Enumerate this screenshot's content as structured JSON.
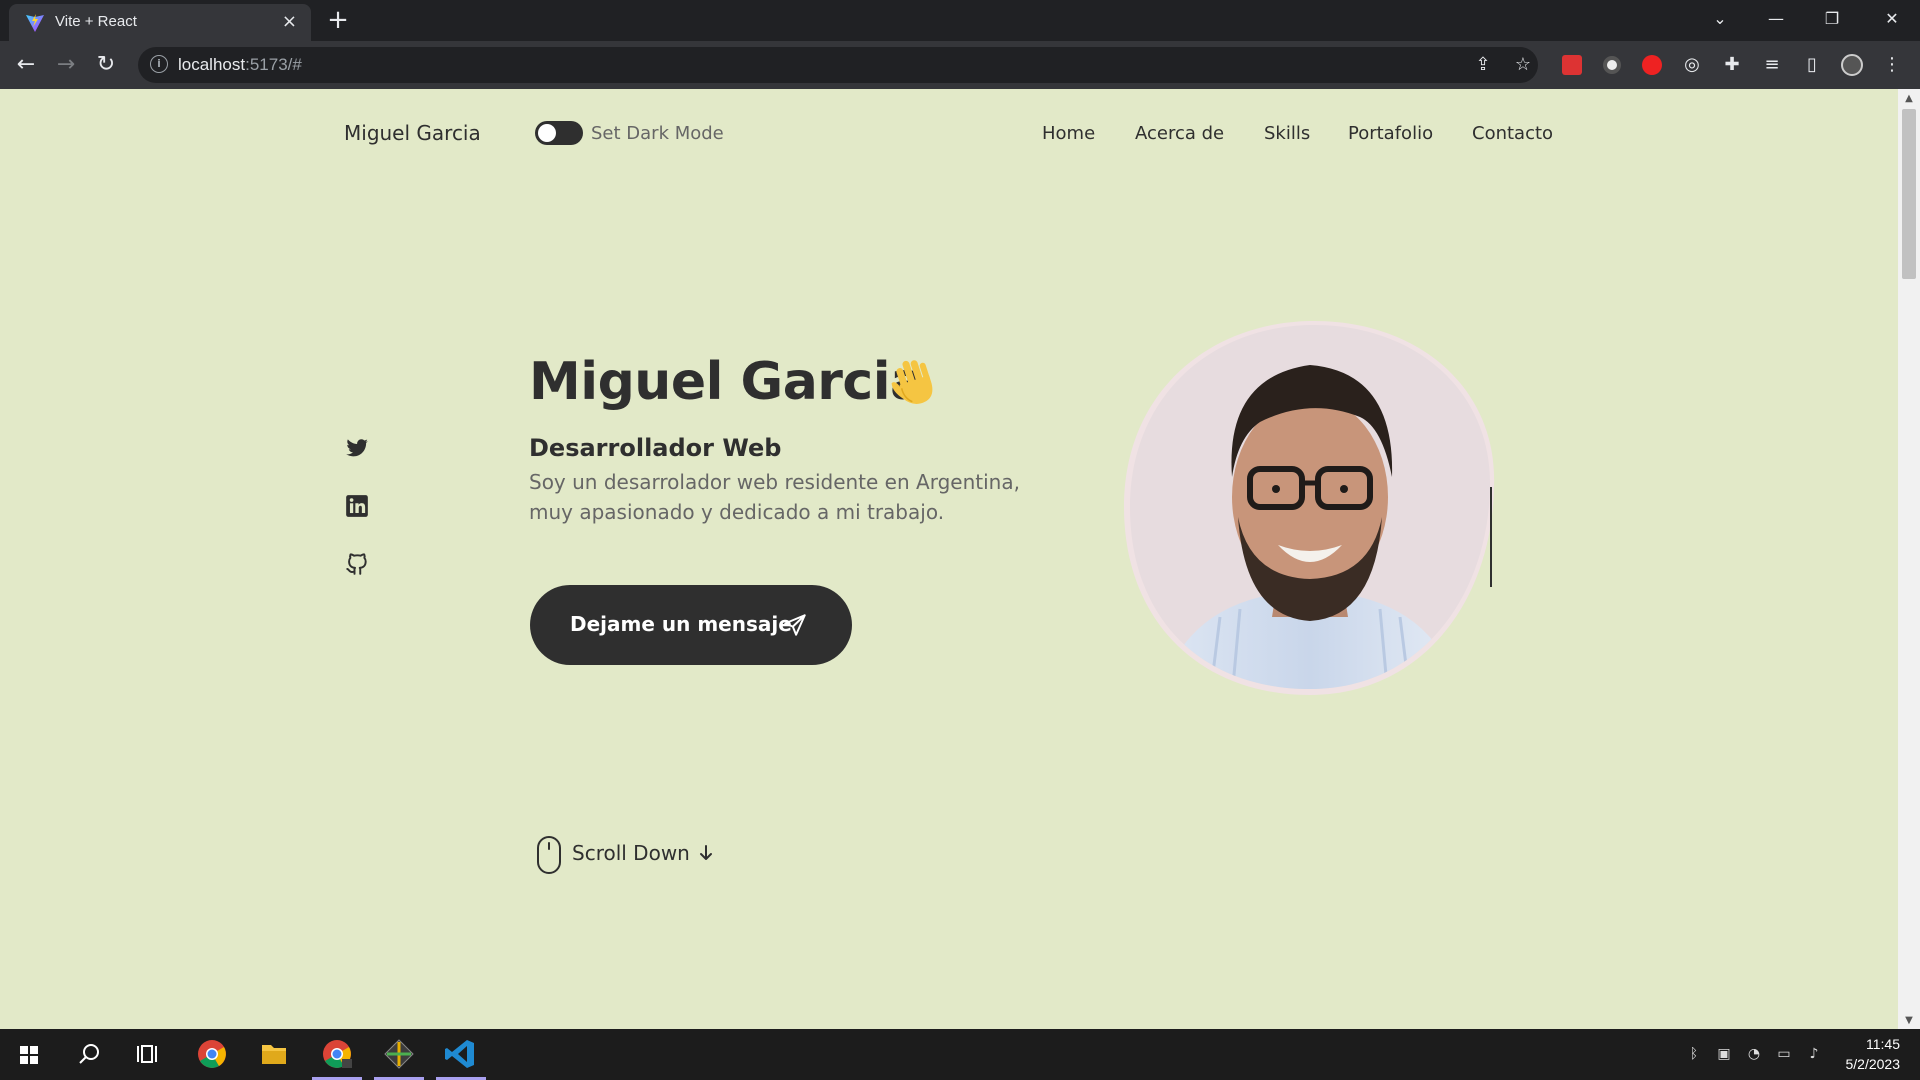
{
  "browser": {
    "tab_title": "Vite + React",
    "tab_close": "×",
    "new_tab": "+",
    "url_host": "localhost",
    "url_path": ":5173/#",
    "extensions": [
      "share-icon",
      "star-icon",
      "ext-red-icon",
      "ext-ring-icon",
      "ext-hand-icon",
      "ext-target-icon",
      "puzzle-icon",
      "media-icon",
      "sidepanel-icon",
      "profile-avatar",
      "menu-icon"
    ]
  },
  "nav": {
    "logo": "Miguel Garcia",
    "dark_mode_label": "Set Dark Mode",
    "items": [
      {
        "label": "Home"
      },
      {
        "label": "Acerca de"
      },
      {
        "label": "Skills"
      },
      {
        "label": "Portafolio"
      },
      {
        "label": "Contacto"
      }
    ]
  },
  "social": [
    "twitter-icon",
    "linkedin-icon",
    "github-icon"
  ],
  "hero": {
    "name": "Miguel Garcia",
    "role": "Desarrollador Web",
    "description": "Soy un desarrolador web residente en Argentina, muy apasionado y dedicado a mi trabajo.",
    "cta_label": "Dejame un mensaje",
    "scroll_label": "Scroll Down"
  },
  "taskbar": {
    "time": "11:45",
    "date": "5/2/2023"
  },
  "colors": {
    "page_bg": "#e2e9c8",
    "text_dark": "#2f2f2f",
    "text_muted": "#666666",
    "button_bg": "#2f2f2f",
    "taskbar_active": "#a9a0ef"
  }
}
